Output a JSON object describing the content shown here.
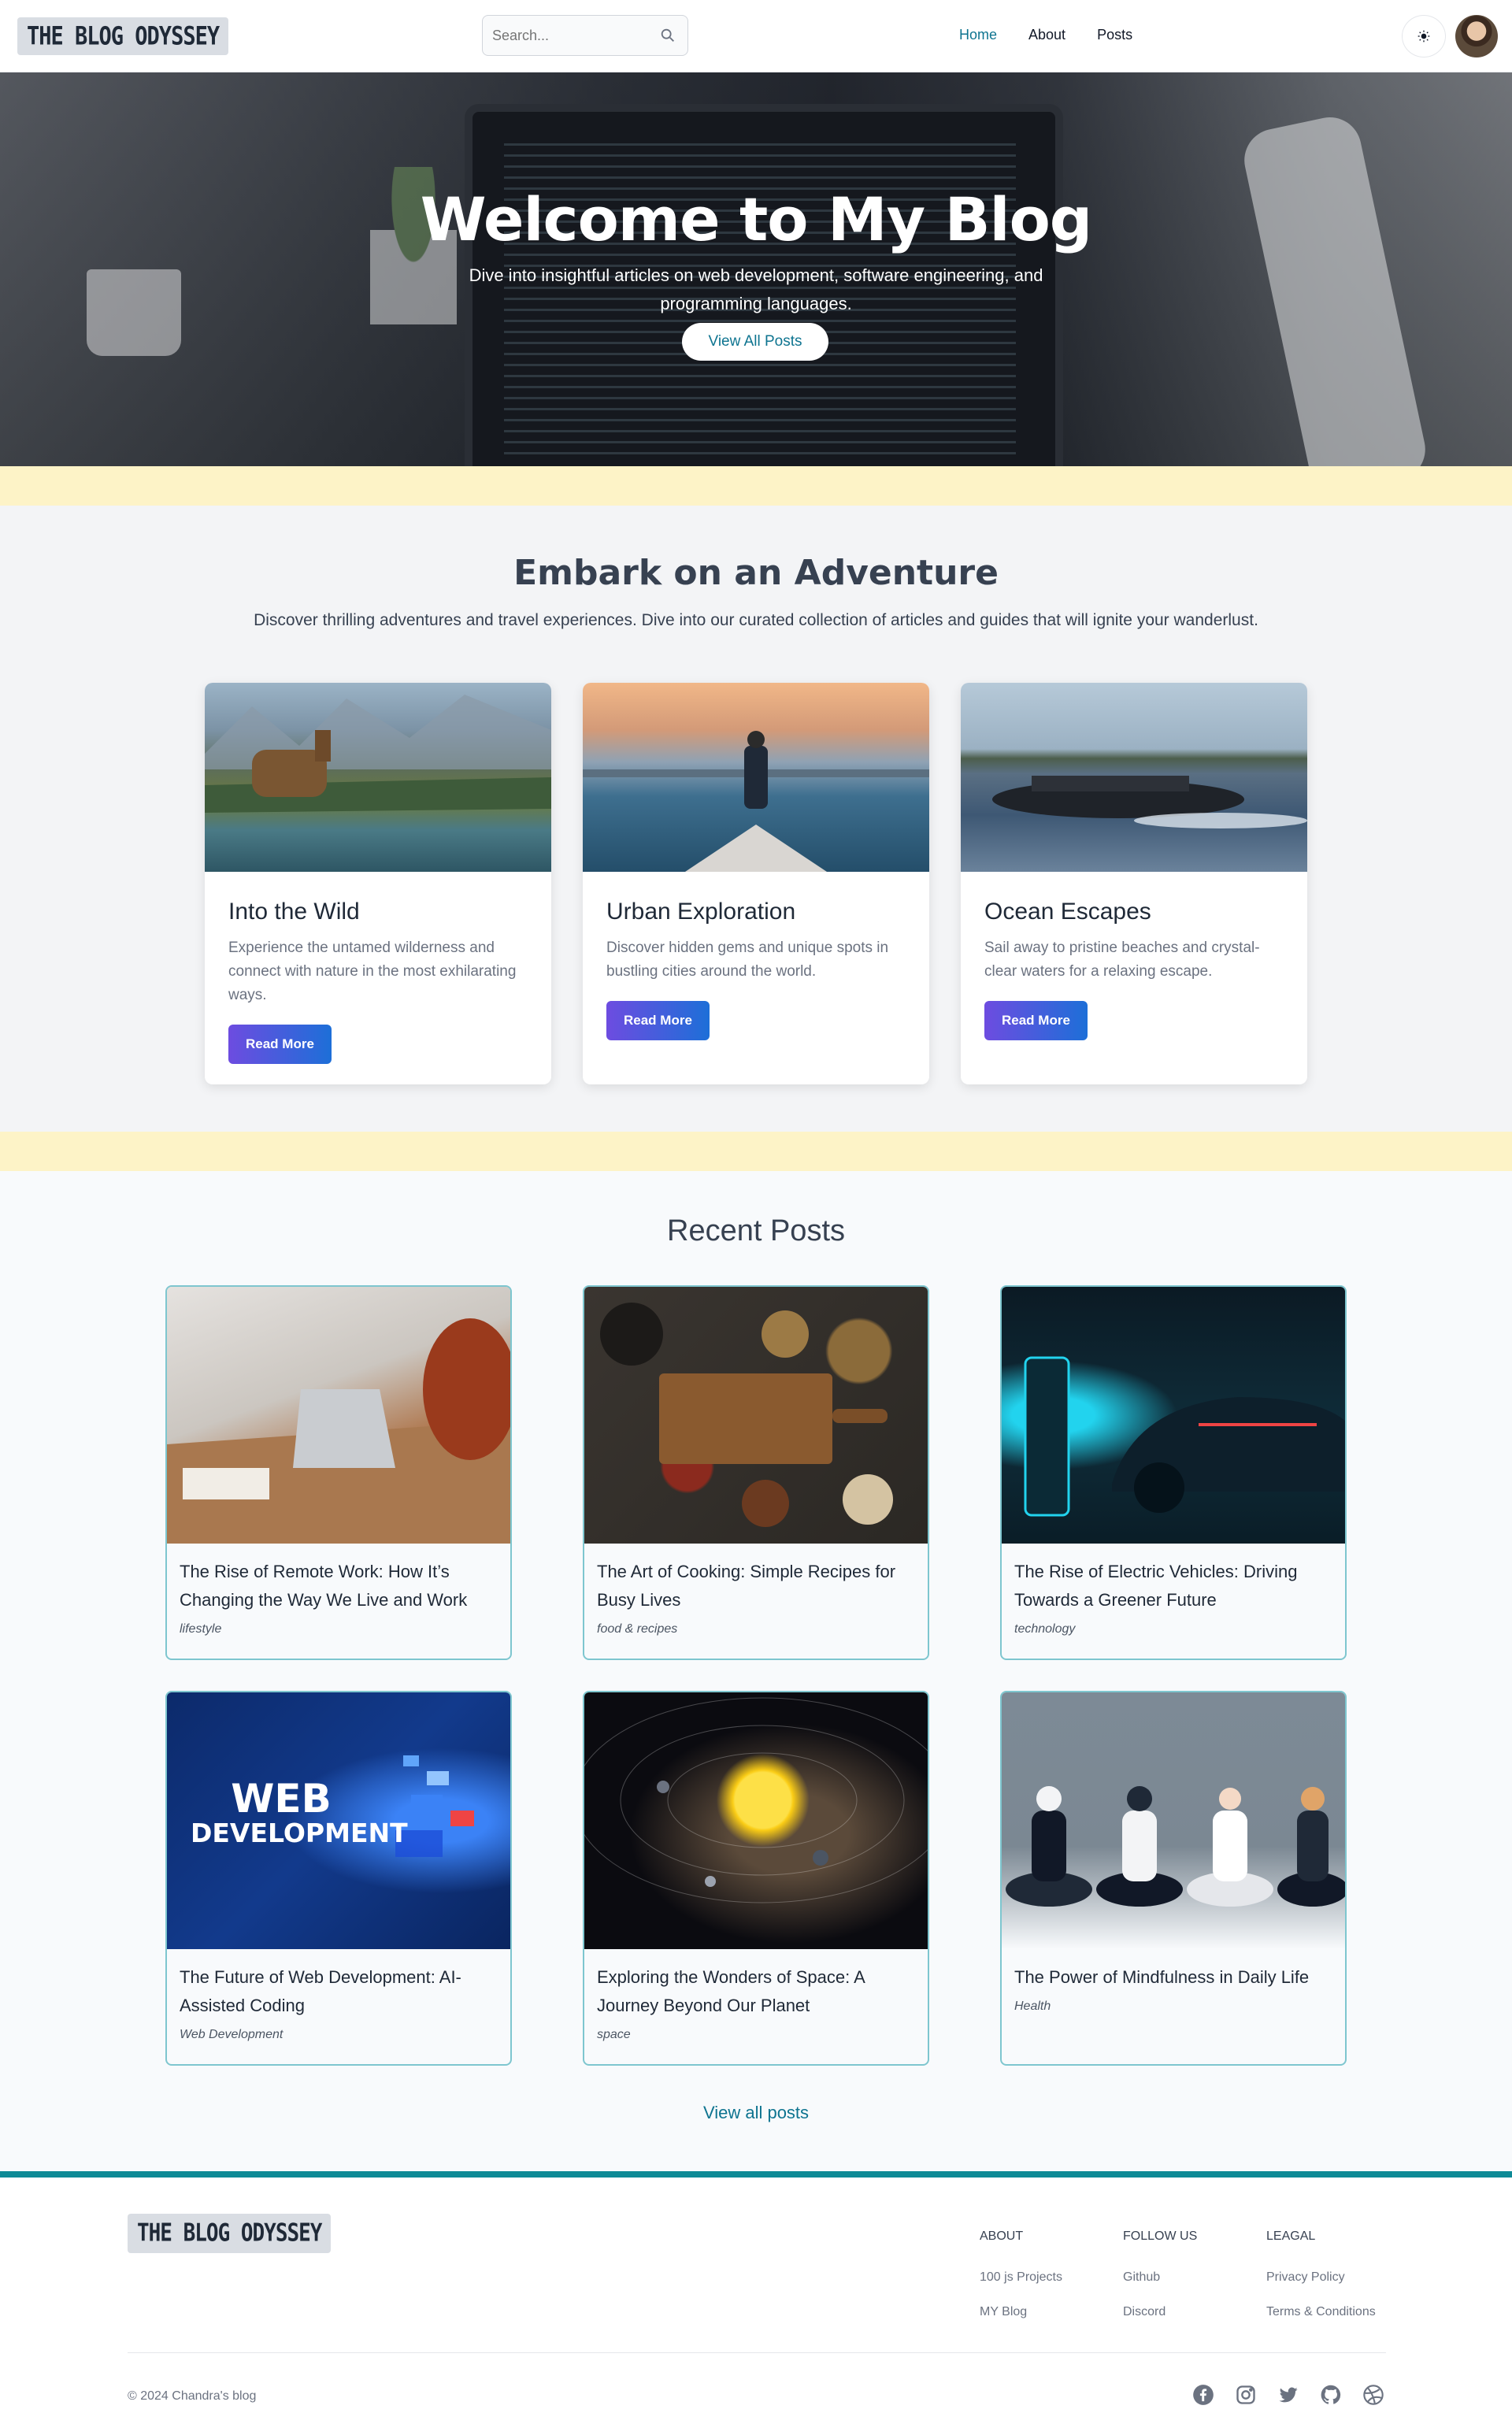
{
  "nav": {
    "logo": "THE BLOG ODYSSEY",
    "search_placeholder": "Search...",
    "links": [
      "Home",
      "About",
      "Posts"
    ],
    "theme_icon": "sun-icon"
  },
  "hero": {
    "title": "Welcome to My Blog",
    "subtitle": "Dive into insightful articles on web development, software engineering, and programming languages.",
    "button": "View All Posts"
  },
  "adventure": {
    "title": "Embark on an Adventure",
    "lead": "Discover thrilling adventures and travel experiences. Dive into our curated collection of articles and guides that will ignite your wanderlust.",
    "cards": [
      {
        "title": "Into the Wild",
        "text": "Experience the untamed wilderness and connect with nature in the most exhilarating ways.",
        "button": "Read More"
      },
      {
        "title": "Urban Exploration",
        "text": "Discover hidden gems and unique spots in bustling cities around the world.",
        "button": "Read More"
      },
      {
        "title": "Ocean Escapes",
        "text": "Sail away to pristine beaches and crystal-clear waters for a relaxing escape.",
        "button": "Read More"
      }
    ]
  },
  "recent": {
    "title": "Recent Posts",
    "posts": [
      {
        "title": "The Rise of Remote Work: How It’s Changing the Way We Live and Work",
        "category": "lifestyle"
      },
      {
        "title": "The Art of Cooking: Simple Recipes for Busy Lives",
        "category": "food & recipes"
      },
      {
        "title": "The Rise of Electric Vehicles: Driving Towards a Greener Future",
        "category": "technology"
      },
      {
        "title": "The Future of Web Development: AI-Assisted Coding",
        "category": "Web Development",
        "image_text_1": "WEB",
        "image_text_2": "DEVELOPMENT"
      },
      {
        "title": "Exploring the Wonders of Space: A Journey Beyond Our Planet",
        "category": "space"
      },
      {
        "title": "The Power of Mindfulness in Daily Life",
        "category": "Health"
      }
    ],
    "view_all": "View all posts"
  },
  "footer": {
    "logo": "THE BLOG ODYSSEY",
    "columns": [
      {
        "head": "ABOUT",
        "links": [
          "100 js Projects",
          "MY Blog"
        ]
      },
      {
        "head": "FOLLOW US",
        "links": [
          "Github",
          "Discord"
        ]
      },
      {
        "head": "LEAGAL",
        "links": [
          "Privacy Policy",
          "Terms & Conditions"
        ]
      }
    ],
    "copyright": "© 2024 Chandra's blog",
    "social_icons": [
      "facebook-icon",
      "instagram-icon",
      "twitter-icon",
      "github-icon",
      "dribbble-icon"
    ]
  },
  "colors": {
    "accent": "#0e7490",
    "band": "#fdf3c7",
    "card_border": "#7ec6cf",
    "button_gradient_start": "#6d4ce0",
    "button_gradient_end": "#1d6fd8"
  }
}
